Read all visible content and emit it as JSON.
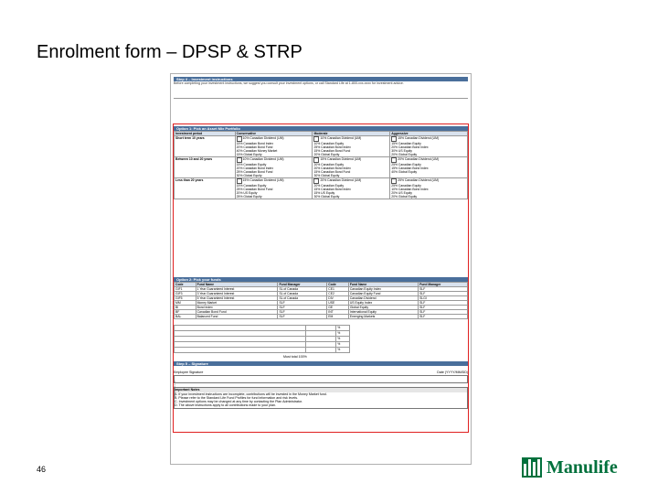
{
  "slide": {
    "title": "Enrolment form – DPSP & STRP",
    "page_number": "46",
    "logo_text": "Manulife"
  },
  "form": {
    "step4_title": "Step 4 – Investment instructions",
    "step4_intro": "Before completing your investment instructions, we suggest you consult your investment options, or call Standard Life at 1-800-xxx-xxxx for investment advice.",
    "option1_title": "Option 1: Pick an Asset Mix Portfolio",
    "option_headers": [
      "Investment period",
      "Conservative",
      "Moderate",
      "Aggressive"
    ],
    "periods": [
      {
        "name": "Short term 10 years",
        "cells": [
          [
            "10% Canadian Dividend (UM)",
            "15% Canadian Bond Index",
            "20% Canadian Bond Fund",
            "40% Canadian Money Market",
            "15% Global Equity"
          ],
          [
            "10% Canadian Dividend (UM)",
            "10% Canadian Equity",
            "25% Canadian Bond Index",
            "15% Canadian Bond Fund",
            "20% Global Equity"
          ],
          [
            "15% Canadian Dividend (UM)",
            "15% Canadian Equity",
            "20% Canadian Bond Index",
            "30% US Equity",
            "20% Global Equity"
          ]
        ]
      },
      {
        "name": "Between 10 and 20 years",
        "cells": [
          [
            "10% Canadian Dividend (UM)",
            "15% Canadian Equity",
            "20% Canadian Bond Index",
            "25% Canadian Bond Fund",
            "30% Global Equity"
          ],
          [
            "15% Canadian Dividend (UM)",
            "20% Canadian Equity",
            "20% Canadian Bond Index",
            "15% Canadian Bond Fund",
            "30% Global Equity"
          ],
          [
            "20% Canadian Dividend (UM)",
            "25% Canadian Equity",
            "15% Canadian Bond Index",
            "40% Global Equity"
          ]
        ]
      },
      {
        "name": "Less than 20 years",
        "cells": [
          [
            "15% Canadian Dividend (UM)",
            "15% Canadian Equity",
            "25% Canadian Bond Fund",
            "20% US Equity",
            "25% Global Equity"
          ],
          [
            "20% Canadian Dividend (UM)",
            "20% Canadian Equity",
            "15% Canadian Bond Index",
            "15% US Equity",
            "30% Global Equity"
          ],
          [
            "25% Canadian Dividend (UM)",
            "25% Canadian Equity",
            "10% Canadian Bond Index",
            "20% US Equity",
            "20% Global Equity"
          ]
        ]
      }
    ],
    "option2_title": "Option 2: Pick your funds",
    "fund_headers": [
      "Code",
      "Fund Name",
      "Fund Manager",
      "Code",
      "Fund Name",
      "Fund Manager"
    ],
    "fund_rows": [
      [
        "GIF1",
        "1 Year Guaranteed Interest",
        "SL of Canada",
        "CE1",
        "Canadian Equity Index",
        "SLF"
      ],
      [
        "GIF3",
        "3 Year Guaranteed Interest",
        "SL of Canada",
        "CE2",
        "Canadian Equity Fund",
        "SLF"
      ],
      [
        "GIF5",
        "5 Year Guaranteed Interest",
        "SL of Canada",
        "DIV",
        "Canadian Dividend",
        "SLGI"
      ],
      [
        "MM",
        "Money Market",
        "SLF",
        "USE",
        "US Equity Index",
        "SLF"
      ],
      [
        "BI",
        "Bond Index",
        "SLF",
        "GE",
        "Global Equity",
        "SLF"
      ],
      [
        "BF",
        "Canadian Bond Fund",
        "SLF",
        "INT",
        "International Equity",
        "SLF"
      ],
      [
        "BAL",
        "Balanced Fund",
        "SLF",
        "EM",
        "Emerging Markets",
        "SLF"
      ]
    ],
    "total_label": "Must total 100%",
    "step5_title": "Step 5 – Signature",
    "signature_labels": [
      "Employee Signature",
      "Date (YYYY/MM/DD)"
    ],
    "notes_title": "Important Notes",
    "notes": [
      "A. If your investment instructions are incomplete, contributions will be invested in the Money Market fund.",
      "B. Please refer to the Standard Life Fund Profiles for fund information and risk levels.",
      "C. Investment options may be changed at any time by contacting the Plan Administrator.",
      "D. The above instructions apply to all contributions made to your plan."
    ],
    "side_note": "Standard Life"
  }
}
